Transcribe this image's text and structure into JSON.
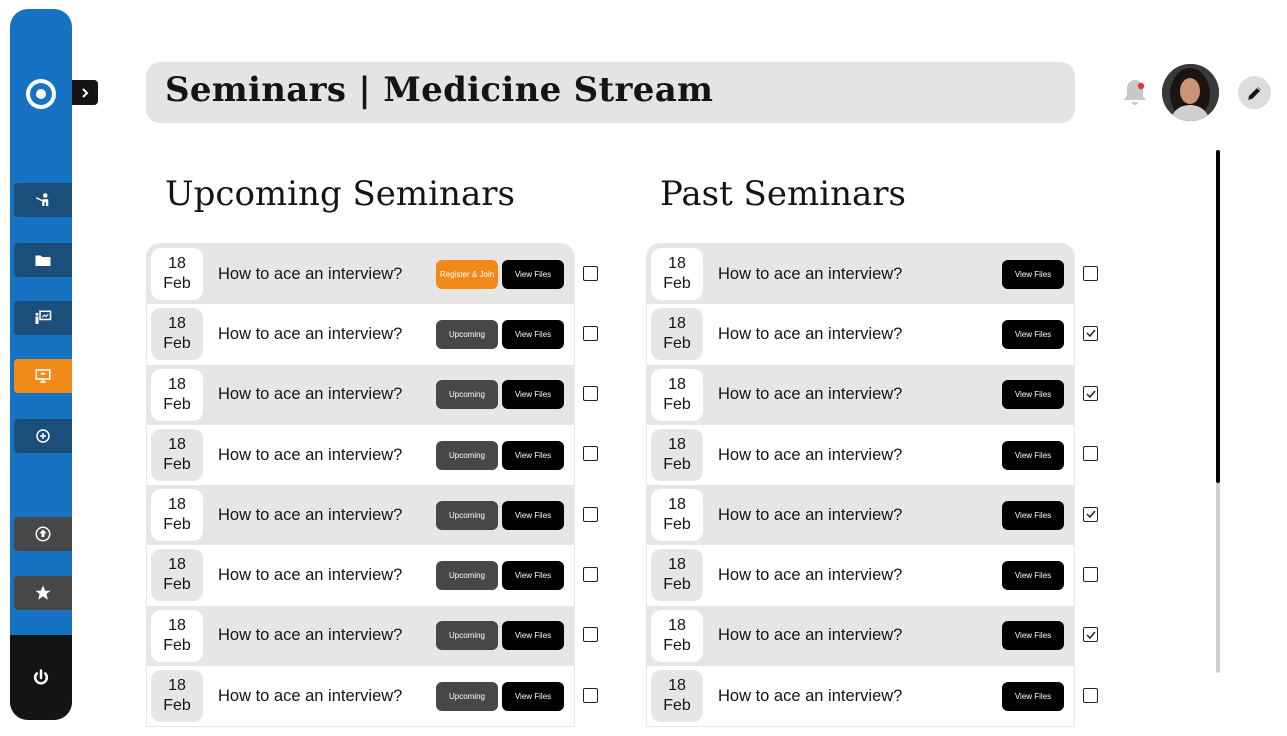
{
  "header": {
    "title": "Seminars | Medicine Stream"
  },
  "sidebar": {
    "logo_icon": "portal-logo-icon",
    "items": [
      {
        "name": "teacher-icon",
        "state": "dark"
      },
      {
        "name": "folder-icon",
        "state": "dark"
      },
      {
        "name": "classroom-icon",
        "state": "dark"
      },
      {
        "name": "seminar-icon",
        "state": "active"
      },
      {
        "name": "add-icon",
        "state": "dark"
      },
      {
        "name": "upload-icon",
        "state": "gray"
      },
      {
        "name": "star-icon",
        "state": "gray"
      }
    ],
    "power_icon": "power-icon",
    "accent_color": "#1672c3",
    "active_color": "#f28a1a"
  },
  "upcoming": {
    "heading": "Upcoming Seminars",
    "rows": [
      {
        "day": "18",
        "month": "Feb",
        "title": "How to ace an interview?",
        "status": "Register & Join",
        "files": "View Files",
        "checked": false
      },
      {
        "day": "18",
        "month": "Feb",
        "title": "How to ace an interview?",
        "status": "Upcoming",
        "files": "View Files",
        "checked": false
      },
      {
        "day": "18",
        "month": "Feb",
        "title": "How to ace an interview?",
        "status": "Upcoming",
        "files": "View Files",
        "checked": false
      },
      {
        "day": "18",
        "month": "Feb",
        "title": "How to ace an interview?",
        "status": "Upcoming",
        "files": "View Files",
        "checked": false
      },
      {
        "day": "18",
        "month": "Feb",
        "title": "How to ace an interview?",
        "status": "Upcoming",
        "files": "View Files",
        "checked": false
      },
      {
        "day": "18",
        "month": "Feb",
        "title": "How to ace an interview?",
        "status": "Upcoming",
        "files": "View Files",
        "checked": false
      },
      {
        "day": "18",
        "month": "Feb",
        "title": "How to ace an interview?",
        "status": "Upcoming",
        "files": "View Files",
        "checked": false
      },
      {
        "day": "18",
        "month": "Feb",
        "title": "How to ace an interview?",
        "status": "Upcoming",
        "files": "View Files",
        "checked": false
      }
    ]
  },
  "past": {
    "heading": "Past Seminars",
    "rows": [
      {
        "day": "18",
        "month": "Feb",
        "title": "How to ace an interview?",
        "files": "View Files",
        "checked": false
      },
      {
        "day": "18",
        "month": "Feb",
        "title": "How to ace an interview?",
        "files": "View Files",
        "checked": true
      },
      {
        "day": "18",
        "month": "Feb",
        "title": "How to ace an interview?",
        "files": "View Files",
        "checked": true
      },
      {
        "day": "18",
        "month": "Feb",
        "title": "How to ace an interview?",
        "files": "View Files",
        "checked": false
      },
      {
        "day": "18",
        "month": "Feb",
        "title": "How to ace an interview?",
        "files": "View Files",
        "checked": true
      },
      {
        "day": "18",
        "month": "Feb",
        "title": "How to ace an interview?",
        "files": "View Files",
        "checked": false
      },
      {
        "day": "18",
        "month": "Feb",
        "title": "How to ace an interview?",
        "files": "View Files",
        "checked": true
      },
      {
        "day": "18",
        "month": "Feb",
        "title": "How to ace an interview?",
        "files": "View Files",
        "checked": false
      }
    ]
  },
  "topbar": {
    "notification_icon": "bell-icon",
    "avatar_icon": "avatar",
    "edit_icon": "pencil-icon",
    "has_unread": true
  }
}
